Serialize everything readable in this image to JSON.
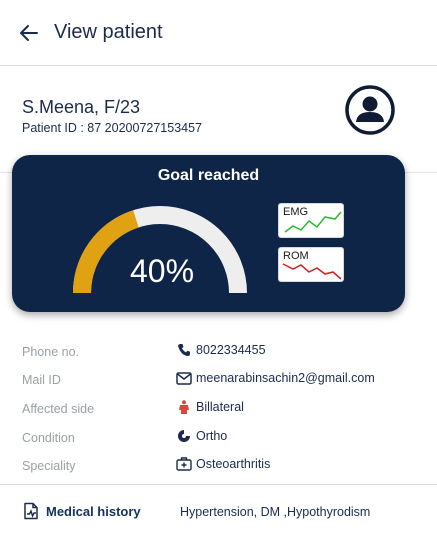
{
  "header": {
    "title": "View patient"
  },
  "patient": {
    "name": "S.Meena, F/23",
    "id_text": "Patient ID : 87 20200727153457"
  },
  "goal": {
    "title": "Goal reached",
    "progress_percent": 40,
    "value_text": "40%",
    "emg_label": "EMG",
    "rom_label": "ROM"
  },
  "details": [
    {
      "label": "Phone no.",
      "value": "8022334455",
      "icon": "phone-icon"
    },
    {
      "label": "Mail ID",
      "value": "meenarabinsachin2@gmail.com",
      "icon": "mail-icon"
    },
    {
      "label": "Affected side",
      "value": "Billateral",
      "icon": "body-icon"
    },
    {
      "label": "Condition",
      "value": "Ortho",
      "icon": "bone-icon"
    },
    {
      "label": "Speciality",
      "value": "Osteoarthritis",
      "icon": "medical-kit-icon"
    }
  ],
  "medical_history": {
    "label": "Medical history",
    "value": "Hypertension, DM ,Hypothyrodism"
  },
  "colors": {
    "navy": "#0f2547",
    "gauge_fill": "#e0a113",
    "gauge_track": "#eeeeee",
    "emg_line": "#2dbb2d",
    "rom_line": "#d32020",
    "body_icon": "#e0463f"
  }
}
